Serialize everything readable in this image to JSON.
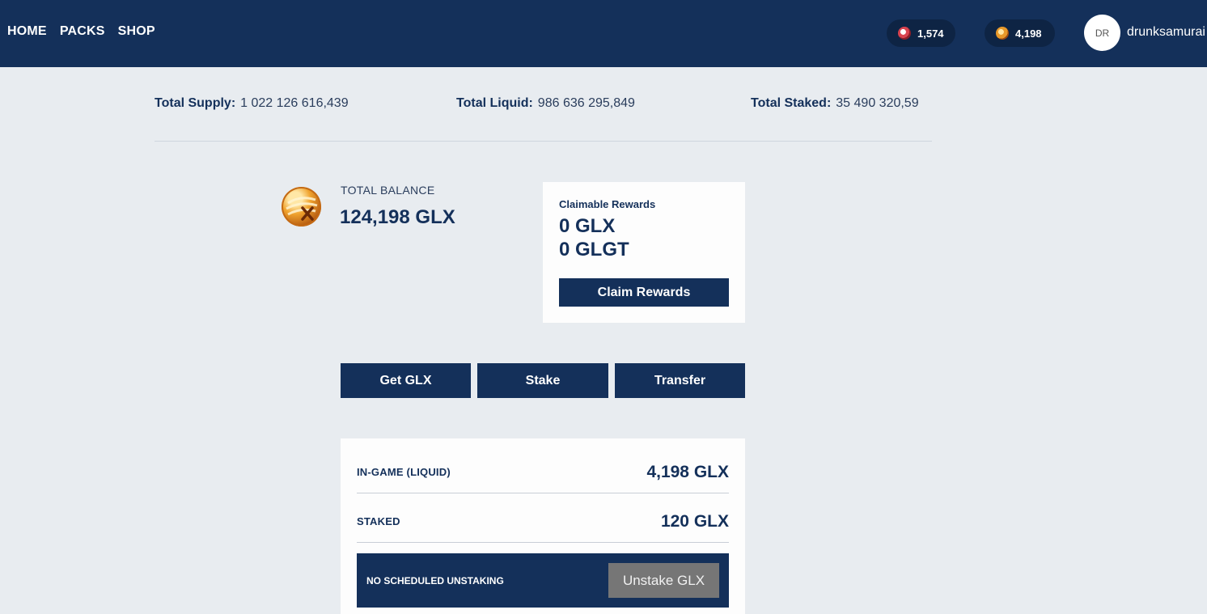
{
  "nav": {
    "items": [
      {
        "label": "HOME"
      },
      {
        "label": "PACKS"
      },
      {
        "label": "SHOP"
      }
    ]
  },
  "header": {
    "currency_1": {
      "value": "1,574",
      "icon": "red-coin-icon"
    },
    "currency_2": {
      "value": "4,198",
      "icon": "gold-coin-icon"
    },
    "avatar_initials": "DR",
    "username": "drunksamurai"
  },
  "stats": {
    "total_supply": {
      "label": "Total Supply:",
      "value": "1 022 126 616,439"
    },
    "total_liquid": {
      "label": "Total Liquid:",
      "value": "986 636 295,849"
    },
    "total_staked": {
      "label": "Total Staked:",
      "value": "35 490 320,59"
    }
  },
  "balance": {
    "label": "TOTAL BALANCE",
    "value": "124,198 GLX"
  },
  "rewards": {
    "title": "Claimable Rewards",
    "glx": "0 GLX",
    "glgt": "0 GLGT",
    "claim_label": "Claim Rewards"
  },
  "actions": {
    "get_label": "Get GLX",
    "stake_label": "Stake",
    "transfer_label": "Transfer"
  },
  "holdings": {
    "liquid": {
      "label": "IN-GAME (LIQUID)",
      "value": "4,198 GLX"
    },
    "staked": {
      "label": "STAKED",
      "value": "120 GLX"
    },
    "unstake_status": "NO SCHEDULED UNSTAKING",
    "unstake_label": "Unstake GLX"
  },
  "colors": {
    "primary": "#14305a",
    "background": "#e8ecf0",
    "disabled": "#767676"
  }
}
